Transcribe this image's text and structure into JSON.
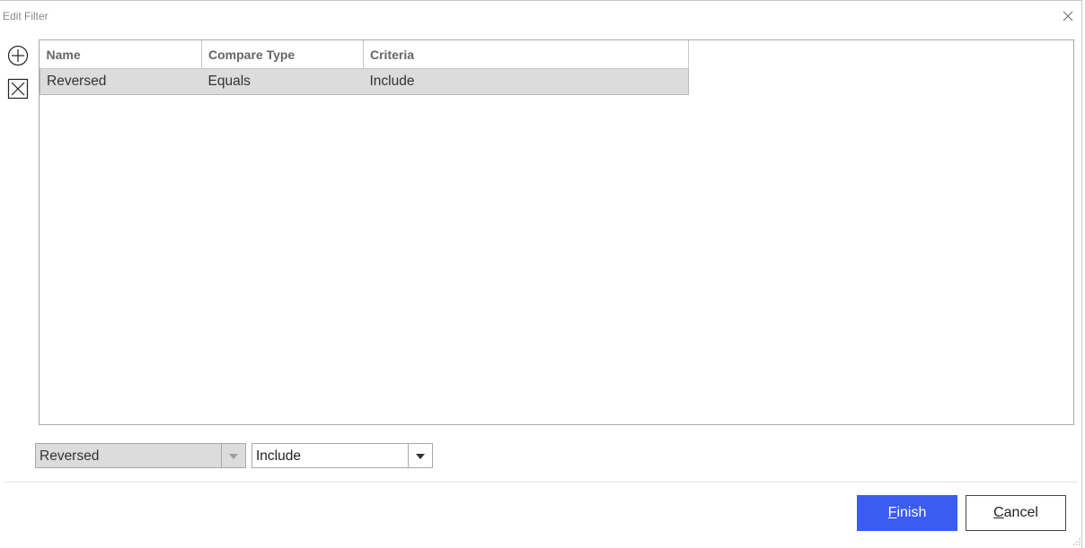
{
  "dialog": {
    "title": "Edit Filter"
  },
  "icons": {
    "add": "add-circle-icon",
    "remove": "remove-x-icon",
    "close": "close-icon",
    "dropdown": "chevron-down-icon"
  },
  "grid": {
    "columns": [
      "Name",
      "Compare Type",
      "Criteria"
    ],
    "rows": [
      {
        "name": "Reversed",
        "compare_type": "Equals",
        "criteria": "Include",
        "selected": true
      }
    ]
  },
  "editor": {
    "name_value": "Reversed",
    "criteria_value": "Include"
  },
  "buttons": {
    "finish": "Finish",
    "cancel": "Cancel"
  },
  "colors": {
    "accent": "#3a5cf0",
    "selected_row": "#dcdcdc"
  }
}
